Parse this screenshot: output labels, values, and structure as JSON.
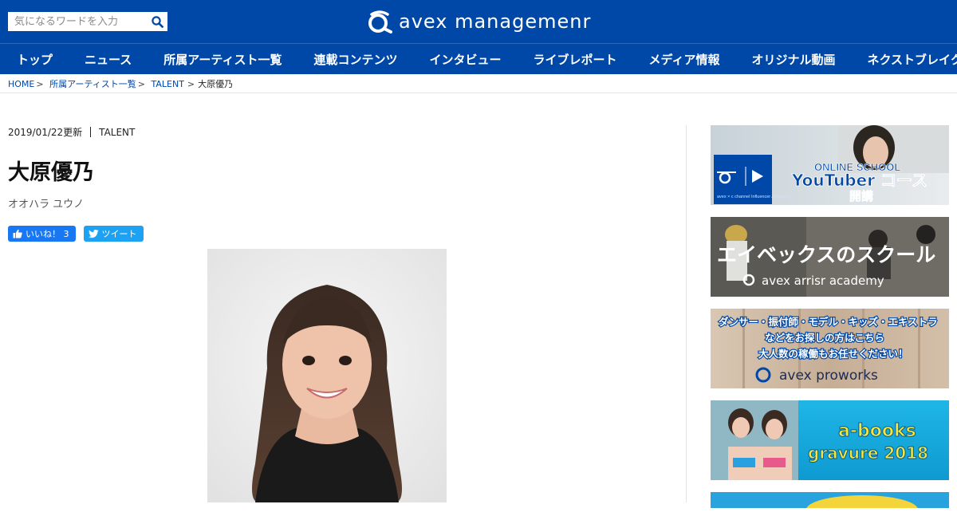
{
  "header": {
    "search_placeholder": "気になるワードを入力",
    "logo_text": "avex managemenr"
  },
  "nav": {
    "items": [
      "トップ",
      "ニュース",
      "所属アーティスト一覧",
      "連載コンテンツ",
      "インタビュー",
      "ライブレポート",
      "メディア情報",
      "オリジナル動画",
      "ネクストブレイク"
    ]
  },
  "breadcrumb": {
    "home": "HOME",
    "artists": "所属アーティスト一覧",
    "category": "TALENT",
    "current": "大原優乃",
    "sep": ">"
  },
  "article": {
    "updated": "2019/01/22更新",
    "category": "TALENT",
    "title": "大原優乃",
    "kana": "オオハラ ユウノ",
    "like_label": "いいね！ 3",
    "tweet_label": "ツイート"
  },
  "sidebar": {
    "banner1": {
      "line1": "ONLINE SCHOOL",
      "line2": "YouTuber コース",
      "line3": "開講",
      "sub": "avex × c channel Influencer Academy"
    },
    "banner2": {
      "line1": "エイベックスのスクール",
      "line2": "avex arrisr academy"
    },
    "banner3": {
      "line1": "ダンサー・振付師・モデル・キッズ・エキストラ",
      "line2": "などをお探しの方はこちら",
      "line3": "大人数の稼働もお任せください！",
      "line4": "avex proworks"
    },
    "banner4": {
      "line1": "a-books",
      "line2": "gravure 2018"
    }
  },
  "colors": {
    "brand_blue": "#0048a8",
    "facebook": "#1877f2",
    "twitter": "#1da1f2"
  }
}
